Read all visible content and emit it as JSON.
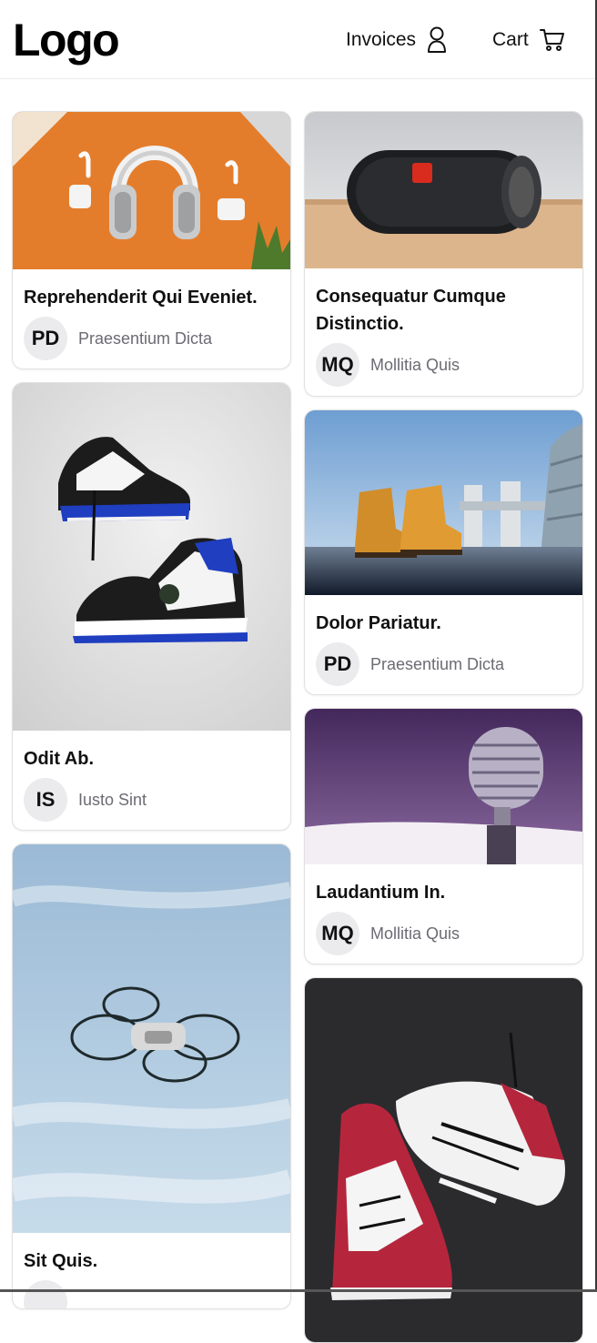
{
  "header": {
    "logo": "Logo",
    "invoices_label": "Invoices",
    "cart_label": "Cart"
  },
  "cards": [
    {
      "title": "Reprehenderit Qui Eveniet.",
      "avatar_initials": "PD",
      "author": "Praesentium Dicta",
      "image": "airpods-max-photo"
    },
    {
      "title": "Consequatur Cumque Distinctio.",
      "avatar_initials": "MQ",
      "author": "Mollitia Quis",
      "image": "jbl-speaker-photo"
    },
    {
      "title": "Odit Ab.",
      "avatar_initials": "IS",
      "author": "Iusto Sint",
      "image": "sneakers-blue-photo"
    },
    {
      "title": "Dolor Pariatur.",
      "avatar_initials": "PD",
      "author": "Praesentium Dicta",
      "image": "boots-london-photo"
    },
    {
      "title": "Laudantium In.",
      "avatar_initials": "MQ",
      "author": "Mollitia Quis",
      "image": "microphone-photo"
    },
    {
      "title": "Sit Quis.",
      "avatar_initials": "",
      "author": "",
      "image": "drone-sky-photo"
    },
    {
      "title": "",
      "avatar_initials": "",
      "author": "",
      "image": "sneakers-red-photo"
    }
  ]
}
